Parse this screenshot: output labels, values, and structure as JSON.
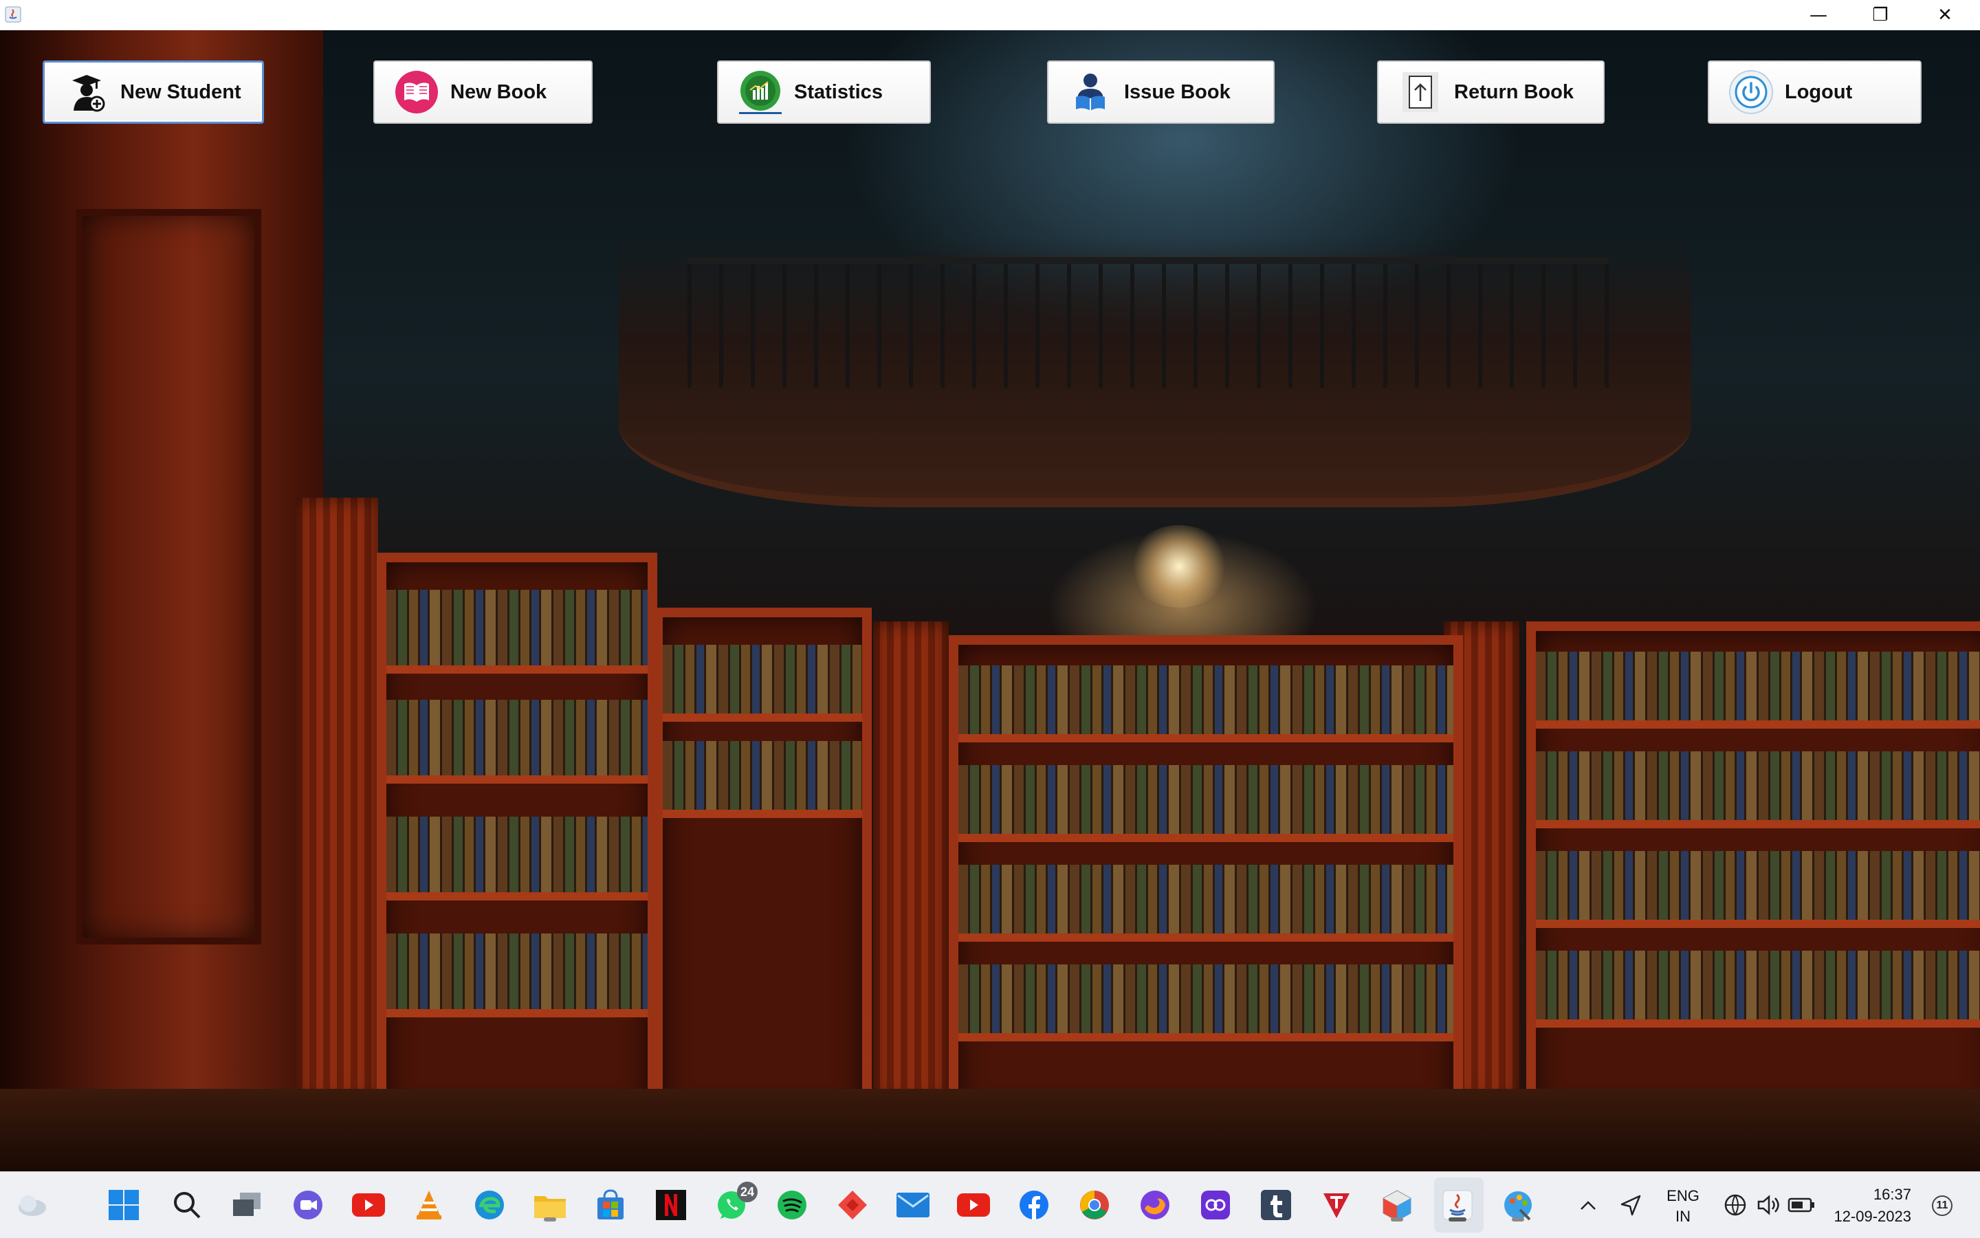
{
  "window": {
    "title": "",
    "controls": {
      "minimize": "—",
      "restore": "❐",
      "close": "✕"
    }
  },
  "toolbar": {
    "buttons": [
      {
        "label": "New Student",
        "icon": "student-add-icon"
      },
      {
        "label": "New Book",
        "icon": "book-icon"
      },
      {
        "label": "Statistics",
        "icon": "statistics-icon"
      },
      {
        "label": "Issue Book",
        "icon": "reader-icon"
      },
      {
        "label": "Return Book",
        "icon": "upload-file-icon"
      },
      {
        "label": "Logout",
        "icon": "power-icon"
      }
    ],
    "active": "New Student"
  },
  "taskbar": {
    "apps": [
      {
        "name": "weather-icon"
      },
      {
        "name": "windows-start-icon"
      },
      {
        "name": "search-icon"
      },
      {
        "name": "task-view-icon"
      },
      {
        "name": "teams-chat-icon"
      },
      {
        "name": "youtube-icon"
      },
      {
        "name": "vlc-icon"
      },
      {
        "name": "edge-icon"
      },
      {
        "name": "file-explorer-icon"
      },
      {
        "name": "microsoft-store-icon"
      },
      {
        "name": "netflix-icon"
      },
      {
        "name": "whatsapp-icon",
        "badge": "24"
      },
      {
        "name": "spotify-icon"
      },
      {
        "name": "anydesk-icon"
      },
      {
        "name": "mail-icon"
      },
      {
        "name": "youtube-icon"
      },
      {
        "name": "facebook-icon"
      },
      {
        "name": "chrome-icon"
      },
      {
        "name": "firefox-icon"
      },
      {
        "name": "clipchamp-icon"
      },
      {
        "name": "tumblr-icon"
      },
      {
        "name": "tubi-icon"
      },
      {
        "name": "cube-app-icon"
      },
      {
        "name": "java-icon"
      },
      {
        "name": "paint-icon"
      }
    ],
    "tray": {
      "language_line1": "ENG",
      "language_line2": "IN",
      "time": "16:37",
      "date": "12-09-2023",
      "notifications": "11"
    }
  },
  "colors": {
    "active_border": "#5a8fd6",
    "taskbar_bg": "#eef0f4",
    "wood": "#8e2c10"
  }
}
